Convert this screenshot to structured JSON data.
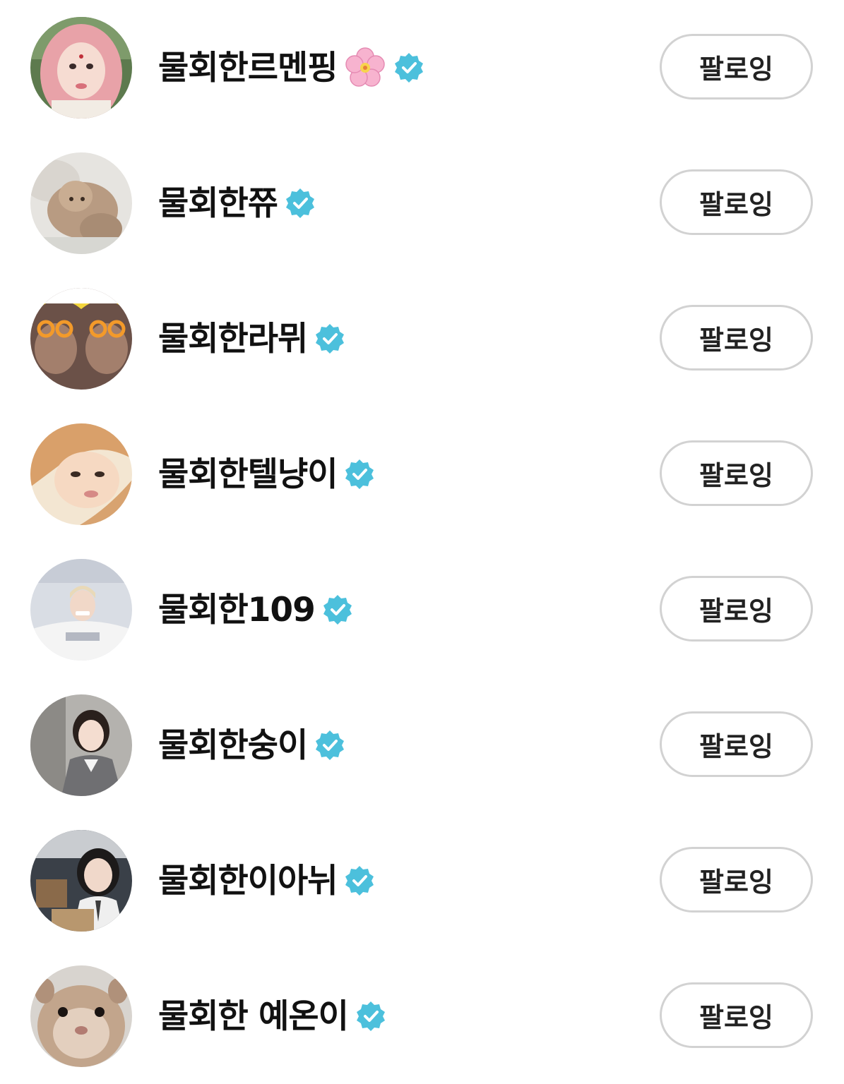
{
  "accent": {
    "verified": "#4cc0dc",
    "button_border": "#d2d2d2"
  },
  "users": [
    {
      "name": "물회한르멘핑",
      "emoji": "cherry-blossom-icon",
      "verified": true,
      "button": "팔로잉",
      "avatar": "avatar-pink-hair-selfie"
    },
    {
      "name": "물회한쮸",
      "verified": true,
      "button": "팔로잉",
      "avatar": "avatar-fluffy-dog"
    },
    {
      "name": "물회한라뮈",
      "verified": true,
      "button": "팔로잉",
      "avatar": "avatar-yellow-hat-duo"
    },
    {
      "name": "물회한텔냥이",
      "verified": true,
      "button": "팔로잉",
      "avatar": "avatar-blonde-selfie"
    },
    {
      "name": "물회한109",
      "verified": true,
      "button": "팔로잉",
      "avatar": "avatar-white-sweatshirt"
    },
    {
      "name": "물회한숭이",
      "verified": true,
      "button": "팔로잉",
      "avatar": "avatar-gray-blazer"
    },
    {
      "name": "물회한이아뉘",
      "verified": true,
      "button": "팔로잉",
      "avatar": "avatar-shirt-tie"
    },
    {
      "name": "물회한 예온이",
      "verified": true,
      "button": "팔로잉",
      "avatar": "avatar-hamster"
    }
  ]
}
